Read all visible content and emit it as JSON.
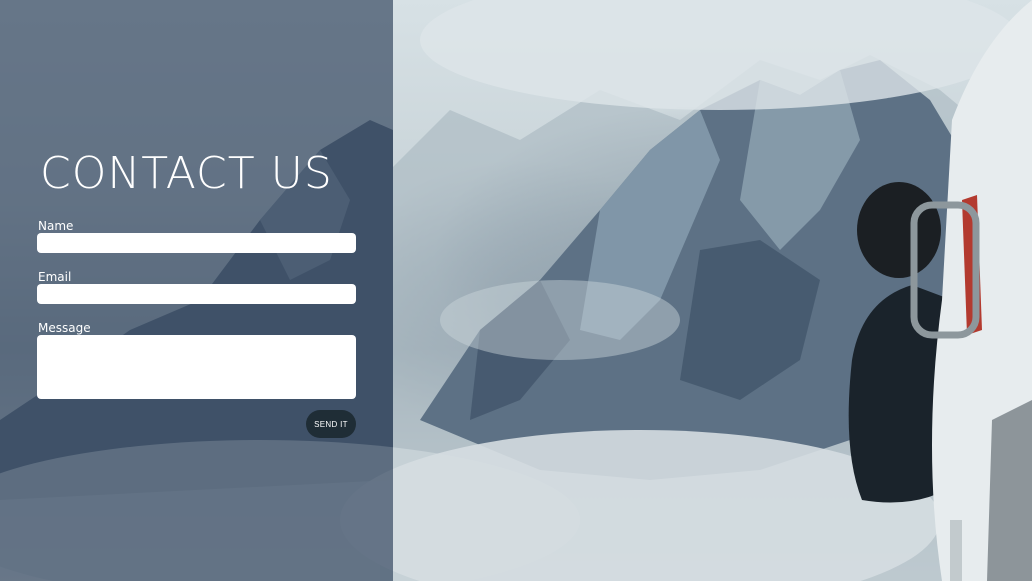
{
  "page": {
    "title": "CONTACT US"
  },
  "form": {
    "name_label": "Name",
    "name_value": "",
    "email_label": "Email",
    "email_value": "",
    "message_label": "Message",
    "message_value": "",
    "submit_label": "SEND IT"
  },
  "background": {
    "image": "mountain-landscape-photo",
    "colors": {
      "panel_overlay": "#3a4c64",
      "button": "#1f2d36"
    }
  }
}
